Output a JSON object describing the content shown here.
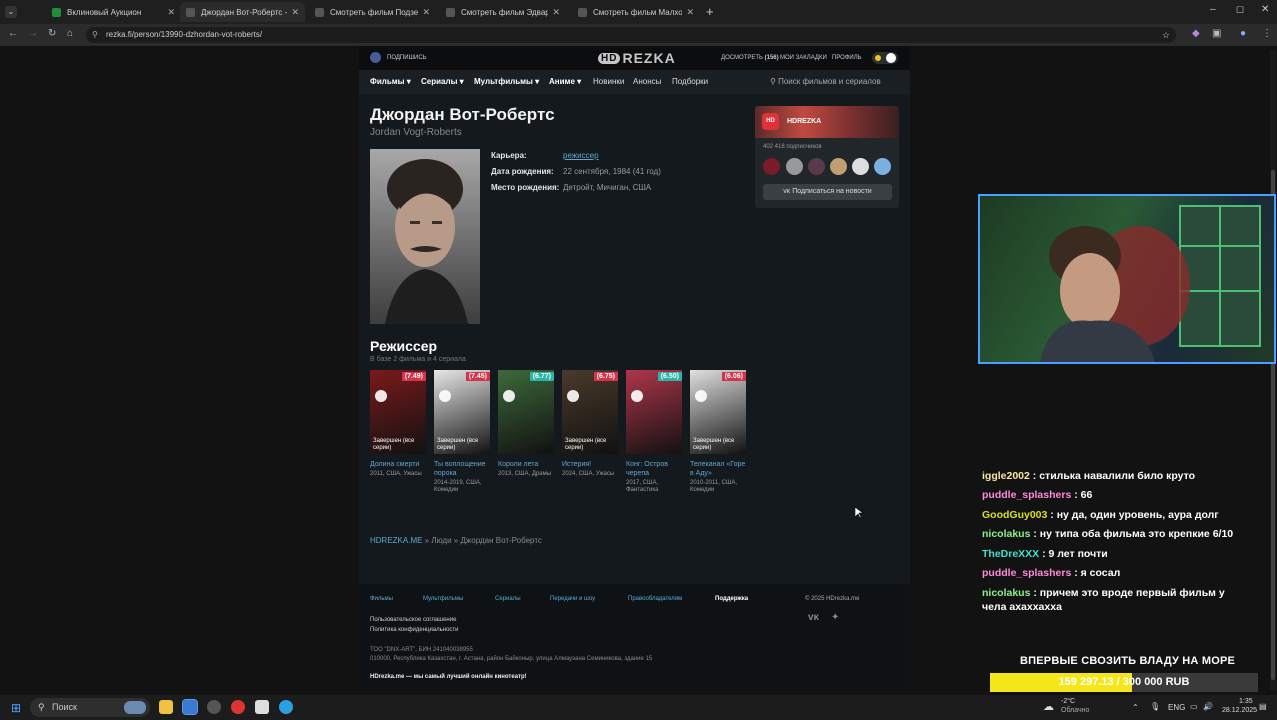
{
  "browser": {
    "tabs": [
      {
        "title": "Вклиновый Аукцион",
        "favicon_color": "#1e8e3e"
      },
      {
        "title": "Джордан Вот-Робертс - смотреть",
        "favicon_color": "#555555"
      },
      {
        "title": "Смотреть фильм Подземель",
        "favicon_color": "#555555"
      },
      {
        "title": "Смотреть фильм Эдвард руки",
        "favicon_color": "#555555"
      },
      {
        "title": "Смотреть фильм Малхолланд",
        "favicon_color": "#555555"
      }
    ],
    "active_tab": 1,
    "url": "rezka.fi/person/13990-dzhordan-vot-roberts/"
  },
  "site": {
    "subscribe": "ПОДПИШИСЬ",
    "logo_hd": "HD",
    "logo_text": "REZKA",
    "top_links": {
      "watched": "ДОСМОТРЕТЬ",
      "watched_count": "(156)",
      "bookmarks": "МОИ ЗАКЛАДКИ",
      "profile": "ПРОФИЛЬ"
    },
    "nav": [
      "Фильмы",
      "Сериалы",
      "Мультфильмы",
      "Аниме",
      "Новинки",
      "Анонсы",
      "Подборки"
    ],
    "search_placeholder": "Поиск фильмов и сериалов",
    "person": {
      "name": "Джордан Вот-Робертс",
      "name_orig": "Jordan Vogt-Roberts",
      "career_label": "Карьера:",
      "career_value": "режиссер",
      "birth_label": "Дата рождения:",
      "birth_value": "22 сентября, 1984 (41 год)",
      "place_label": "Место рождения:",
      "place_value": "Детройт, Мичиган, США"
    },
    "section": {
      "title": "Режиссер",
      "subtitle": "В базе 2 фильма и 4 сериала"
    },
    "works": [
      {
        "rating": "(7.49)",
        "status": "Завершен (все серии)",
        "title": "Долина смерти",
        "meta": "2011, США, Ужасы",
        "badge_color": "#d6334a",
        "poster_color": "#7a1a1a"
      },
      {
        "rating": "(7.45)",
        "status": "Завершен (все серии)",
        "title": "Ты воплощение порока",
        "meta": "2014-2019, США, Комедии",
        "badge_color": "#d6334a",
        "poster_color": "#e8e8e8"
      },
      {
        "rating": "(6.77)",
        "status": "",
        "title": "Короли лета",
        "meta": "2013, США, Драмы",
        "badge_color": "#2ab3a6",
        "poster_color": "#3d6a3a"
      },
      {
        "rating": "(6.75)",
        "status": "Завершен (все серии)",
        "title": "Истерия!",
        "meta": "2024, США, Ужасы",
        "badge_color": "#d6334a",
        "poster_color": "#4a3a2a"
      },
      {
        "rating": "(6.50)",
        "status": "",
        "title": "Конг: Остров черепа",
        "meta": "2017, США, Фантастика",
        "badge_color": "#2ab3a6",
        "poster_color": "#b0364a"
      },
      {
        "rating": "(6.06)",
        "status": "Завершен (все серии)",
        "title": "Телеканал «Горе в Аду»",
        "meta": "2010-2011, США, Комедии",
        "badge_color": "#d6334a",
        "poster_color": "#e0e0e0"
      }
    ],
    "breadcrumb": {
      "home": "HDREZKA.ME",
      "people": "Люди",
      "current": "Джордан Вот-Робертс"
    },
    "vk_widget": {
      "title": "HDREZKA",
      "subscribers": "402 418 подписчиков",
      "button": "Подписаться на новости"
    },
    "footer": {
      "links": [
        "Фильмы",
        "Мультфильмы",
        "Сериалы",
        "Передачи и шоу",
        "Правообладателям",
        "Поддержка"
      ],
      "copyright": "© 2025 HDrezka.me",
      "terms": "Пользовательское соглашение",
      "privacy": "Политика конфиденциальности",
      "company": "ТОО \"DNX-ART\", БИН 241040038955",
      "address": "010000, Республика Казахстан, г. Астана, район Байконыр, улица Алмауэана Семиникова, здание 15",
      "tagline": "HDrezka.me — мы самый лучший онлайн кинотеатр!"
    }
  },
  "stream": {
    "chat": [
      {
        "user": "iggle2002",
        "text": ": стилька навалили било круто",
        "color": "#f5e8a0"
      },
      {
        "user": "puddle_splashers",
        "text": ": 66",
        "color": "#ff8ad8"
      },
      {
        "user": "GoodGuy003",
        "text": ": ну да, один уровень, аура долг",
        "color": "#d8e020"
      },
      {
        "user": "nicolakus",
        "text": ": ну типа оба фильма это крепкие 6/10",
        "color": "#8cf08c"
      },
      {
        "user": "TheDreXXX",
        "text": ": 9 лет почти",
        "color": "#40e0d0"
      },
      {
        "user": "puddle_splashers",
        "text": ": я сосал",
        "color": "#ff8ad8"
      },
      {
        "user": "nicolakus",
        "text": ": причем это вроде первый фильм у чела ахаххахха",
        "color": "#8cf08c"
      }
    ],
    "promo": "ВПЕРВЫЕ СВОЗИТЬ ВЛАДУ НА МОРЕ",
    "goal_text": "159 297.13 / 300 000 RUB",
    "goal_fraction": 0.531
  },
  "taskbar": {
    "search": "Поиск",
    "weather_temp": "-2°C",
    "weather_desc": "Облачно",
    "lang": "ENG",
    "time": "1:35",
    "date": "28.12.2025"
  }
}
